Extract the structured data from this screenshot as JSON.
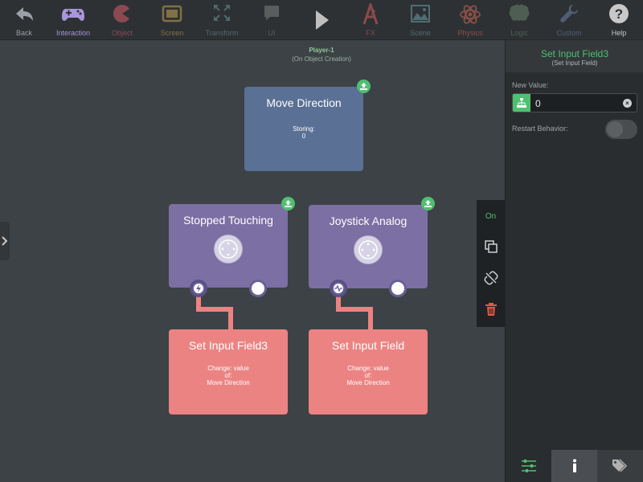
{
  "toolbar": {
    "items": [
      {
        "label": "Back",
        "icon": "back-arrow-icon",
        "color": "#9aa0a6"
      },
      {
        "label": "Interaction",
        "icon": "gamepad-icon",
        "color": "#a796d8"
      },
      {
        "label": "Object",
        "icon": "pacman-icon",
        "color": "#8b4a52"
      },
      {
        "label": "Screen",
        "icon": "screen-icon",
        "color": "#807044"
      },
      {
        "label": "Transform",
        "icon": "transform-icon",
        "color": "#4f6a6c"
      },
      {
        "label": "UI",
        "icon": "ui-bubble-icon",
        "color": "#5a5c5e"
      },
      {
        "label": "",
        "icon": "play-icon",
        "color": "#bfbfbf"
      },
      {
        "label": "FX",
        "icon": "fx-icon",
        "color": "#8b4a4a"
      },
      {
        "label": "Scene",
        "icon": "scene-icon",
        "color": "#4f6e72"
      },
      {
        "label": "Physics",
        "icon": "atom-icon",
        "color": "#8b5048"
      },
      {
        "label": "Logic",
        "icon": "brain-icon",
        "color": "#4f5e52"
      },
      {
        "label": "Custom",
        "icon": "wrench-icon",
        "color": "#4f5e72"
      },
      {
        "label": "Help",
        "icon": "help-icon",
        "color": "#c8c8c8"
      }
    ]
  },
  "canvas": {
    "object_name": "Player-1",
    "object_event": "(On Object Creation)",
    "nodes": {
      "move_direction": {
        "title": "Move Direction",
        "info_line1": "Storing:",
        "info_line2": "0"
      },
      "stopped_touching": {
        "title": "Stopped Touching"
      },
      "joystick_analog": {
        "title": "Joystick Analog"
      },
      "set_input_field3": {
        "title": "Set Input Field3",
        "info_line1": "Change: value",
        "info_line2": "of:",
        "info_line3": "Move Direction"
      },
      "set_input_field": {
        "title": "Set Input Field",
        "info_line1": "Change: value",
        "info_line2": "of:",
        "info_line3": "Move Direction"
      }
    }
  },
  "context_menu": {
    "on_label": "On"
  },
  "panel": {
    "title": "Set Input Field3",
    "subtitle": "(Set Input Field)",
    "new_value_label": "New Value:",
    "new_value": "0",
    "restart_label": "Restart Behavior:",
    "restart_enabled": false
  },
  "colors": {
    "accent": "#4fbf71",
    "node_blue": "#5a7095",
    "node_purple": "#7c6fa3",
    "node_red": "#ec8383"
  }
}
